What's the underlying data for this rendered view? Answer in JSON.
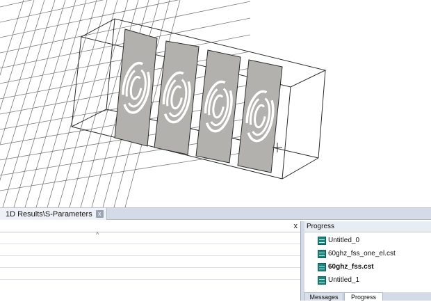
{
  "results_tab": {
    "label": "1D Results\\S-Parameters",
    "close_symbol": "x"
  },
  "results_panel": {
    "close_symbol": "x",
    "sort_indicator": "^"
  },
  "progress_panel": {
    "title": "Progress",
    "items": [
      {
        "label": "Untitled_0",
        "icon": "simulation-icon",
        "bold": false
      },
      {
        "label": "60ghz_fss_one_el.cst",
        "icon": "simulation-icon",
        "bold": false
      },
      {
        "label": "60ghz_fss.cst",
        "icon": "simulation-icon",
        "bold": true
      },
      {
        "label": "Untitled_1",
        "icon": "simulation-icon",
        "bold": false
      }
    ]
  },
  "bottom_tabs": {
    "messages": "Messages",
    "progress": "Progress"
  },
  "colors": {
    "panel_background": "#d4dbe7",
    "element_fill": "#b3b1ae",
    "wire_color": "#222222",
    "icon_teal": "#18877f"
  }
}
